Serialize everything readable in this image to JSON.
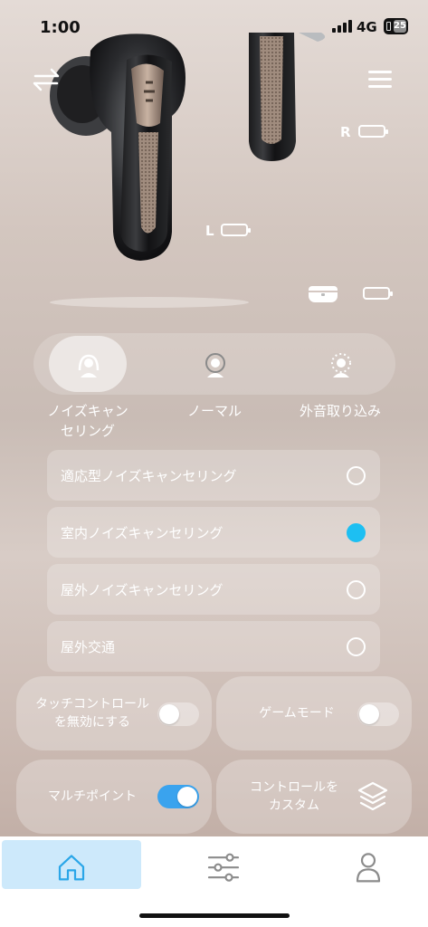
{
  "status_bar": {
    "time": "1:00",
    "network": "4G",
    "battery": "25"
  },
  "header": {
    "swap_icon": "swap-arrows-icon",
    "menu_icon": "hamburger-menu-icon"
  },
  "earbuds": {
    "right_label": "R",
    "left_label": "L",
    "case_icon": "charging-case-icon"
  },
  "modes": [
    {
      "label": "ノイズキャン\nセリング",
      "icon": "noise-cancelling-icon",
      "active": true
    },
    {
      "label": "ノーマル",
      "icon": "normal-mode-icon",
      "active": false
    },
    {
      "label": "外音取り込み",
      "icon": "ambient-sound-icon",
      "active": false
    }
  ],
  "anc_options": [
    {
      "label": "適応型ノイズキャンセリング",
      "selected": false
    },
    {
      "label": "室内ノイズキャンセリング",
      "selected": true
    },
    {
      "label": "屋外ノイズキャンセリング",
      "selected": false
    },
    {
      "label": "屋外交通",
      "selected": false
    }
  ],
  "tiles": {
    "touch_control": {
      "label": "タッチコントロール\nを無効にする",
      "enabled": false
    },
    "game_mode": {
      "label": "ゲームモード",
      "enabled": false
    },
    "multipoint": {
      "label": "マルチポイント",
      "enabled": true
    },
    "custom_control": {
      "label": "コントロールを\nカスタム",
      "icon": "layers-icon"
    }
  },
  "bottom_nav": [
    {
      "name": "home",
      "icon": "home-icon",
      "active": true
    },
    {
      "name": "equalizer",
      "icon": "sliders-icon",
      "active": false
    },
    {
      "name": "profile",
      "icon": "person-icon",
      "active": false
    }
  ],
  "colors": {
    "accent": "#1dbff2",
    "toggle_on": "#3aa3ee",
    "nav_active": "#cde9fb",
    "nav_icon_active": "#2aa6e8"
  }
}
